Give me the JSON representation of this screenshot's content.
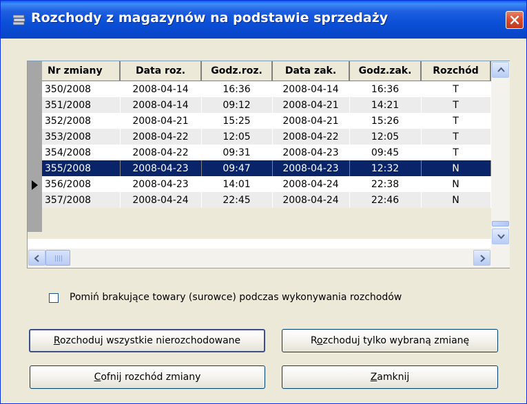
{
  "window": {
    "title": "Rozchody z magazynów na podstawie sprzedaży",
    "title_icon": "app-icon",
    "close_icon": "close-icon"
  },
  "grid": {
    "columns": [
      "Nr zmiany",
      "Data roz.",
      "Godz.roz.",
      "Data zak.",
      "Godz.zak.",
      "Rozchód"
    ],
    "rows": [
      [
        "350/2008",
        "2008-04-14",
        "16:36",
        "2008-04-14",
        "16:36",
        "T"
      ],
      [
        "351/2008",
        "2008-04-14",
        "09:12",
        "2008-04-21",
        "14:21",
        "T"
      ],
      [
        "352/2008",
        "2008-04-21",
        "15:25",
        "2008-04-21",
        "15:26",
        "T"
      ],
      [
        "353/2008",
        "2008-04-22",
        "12:05",
        "2008-04-22",
        "12:05",
        "T"
      ],
      [
        "354/2008",
        "2008-04-22",
        "09:31",
        "2008-04-23",
        "09:45",
        "T"
      ],
      [
        "355/2008",
        "2008-04-23",
        "09:47",
        "2008-04-23",
        "12:32",
        "N"
      ],
      [
        "356/2008",
        "2008-04-23",
        "14:01",
        "2008-04-24",
        "22:38",
        "N"
      ],
      [
        "357/2008",
        "2008-04-24",
        "22:45",
        "2008-04-24",
        "22:46",
        "N"
      ]
    ],
    "selected_row": 5,
    "selected_color": "#0A246A"
  },
  "options": {
    "skip_missing_label": "Pomiń brakujące towary (surowce) podczas wykonywania rozchodów",
    "skip_missing_checked": false
  },
  "buttons": {
    "all_pending": {
      "mnemonic": "R",
      "rest": "ozchoduj wszystkie nierozchodowane"
    },
    "selected_only": {
      "pre": "R",
      "mnemonic": "o",
      "rest": "zchoduj tylko wybraną zmianę"
    },
    "undo": {
      "mnemonic": "C",
      "rest": "ofnij rozchód zmiany"
    },
    "close": {
      "mnemonic": "Z",
      "rest": "amknij"
    }
  }
}
